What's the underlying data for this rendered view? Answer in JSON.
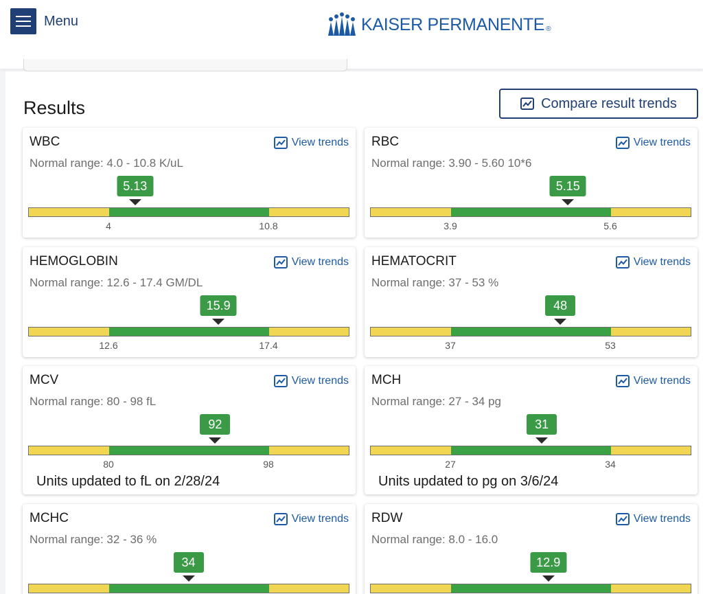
{
  "header": {
    "menu_label": "Menu",
    "logo_text": "KAISER PERMANENTE",
    "logo_reg": "®"
  },
  "main": {
    "title": "Results",
    "compare_label": "Compare result trends",
    "trends_label": "View trends"
  },
  "colors": {
    "brand": "#1f3f75",
    "link": "#1d5aa6",
    "in_range": "#3a9a45",
    "out_range": "#f1d653"
  },
  "results": [
    {
      "name": "WBC",
      "range": "Normal range: 4.0 - 10.8 K/uL",
      "value": "5.13",
      "low": "4",
      "high": "10.8",
      "value_num": 5.13,
      "low_num": 4.0,
      "high_num": 10.8,
      "note": ""
    },
    {
      "name": "RBC",
      "range": "Normal range: 3.90 - 5.60 10*6",
      "value": "5.15",
      "low": "3.9",
      "high": "5.6",
      "value_num": 5.15,
      "low_num": 3.9,
      "high_num": 5.6,
      "note": ""
    },
    {
      "name": "HEMOGLOBIN",
      "range": "Normal range: 12.6 - 17.4 GM/DL",
      "value": "15.9",
      "low": "12.6",
      "high": "17.4",
      "value_num": 15.9,
      "low_num": 12.6,
      "high_num": 17.4,
      "note": ""
    },
    {
      "name": "HEMATOCRIT",
      "range": "Normal range: 37 - 53 %",
      "value": "48",
      "low": "37",
      "high": "53",
      "value_num": 48,
      "low_num": 37,
      "high_num": 53,
      "note": ""
    },
    {
      "name": "MCV",
      "range": "Normal range: 80 - 98 fL",
      "value": "92",
      "low": "80",
      "high": "98",
      "value_num": 92,
      "low_num": 80,
      "high_num": 98,
      "note": "Units updated to fL on 2/28/24"
    },
    {
      "name": "MCH",
      "range": "Normal range: 27 - 34 pg",
      "value": "31",
      "low": "27",
      "high": "34",
      "value_num": 31,
      "low_num": 27,
      "high_num": 34,
      "note": "Units updated to pg on 3/6/24"
    },
    {
      "name": "MCHC",
      "range": "Normal range: 32 - 36 %",
      "value": "34",
      "low": "",
      "high": "",
      "value_num": 34,
      "low_num": 32,
      "high_num": 36,
      "note": ""
    },
    {
      "name": "RDW",
      "range": "Normal range: 8.0 - 16.0",
      "value": "12.9",
      "low": "",
      "high": "",
      "value_num": 12.9,
      "low_num": 8.0,
      "high_num": 16.0,
      "note": ""
    }
  ]
}
